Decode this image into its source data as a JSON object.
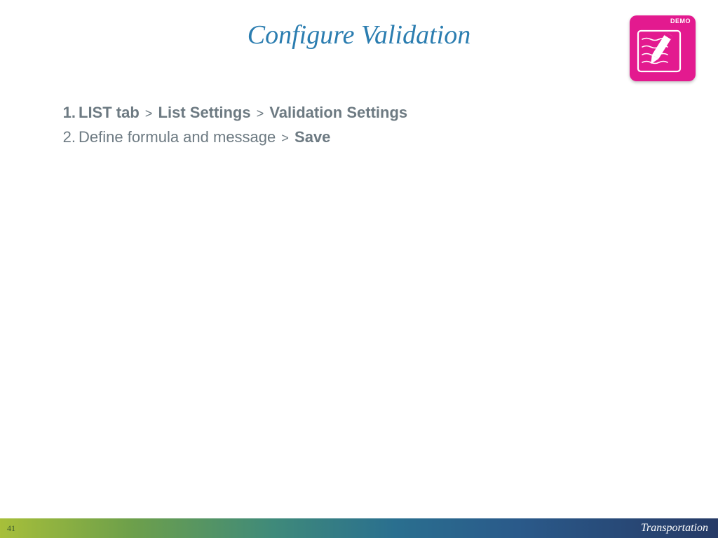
{
  "title": "Configure Validation",
  "demo": {
    "label": "DEMO"
  },
  "steps": [
    {
      "num": "1.",
      "segments": [
        {
          "text": "LIST tab",
          "bold": true
        },
        {
          "text": ">",
          "gt": true
        },
        {
          "text": "List Settings",
          "bold": true
        },
        {
          "text": ">",
          "gt": true
        },
        {
          "text": "Validation Settings",
          "bold": true
        }
      ]
    },
    {
      "num": "2.",
      "segments": [
        {
          "text": "Define formula and message",
          "bold": false
        },
        {
          "text": ">",
          "gt": true
        },
        {
          "text": "Save",
          "bold": true
        }
      ]
    }
  ],
  "footer": {
    "page": "41",
    "brand": "Transportation"
  }
}
